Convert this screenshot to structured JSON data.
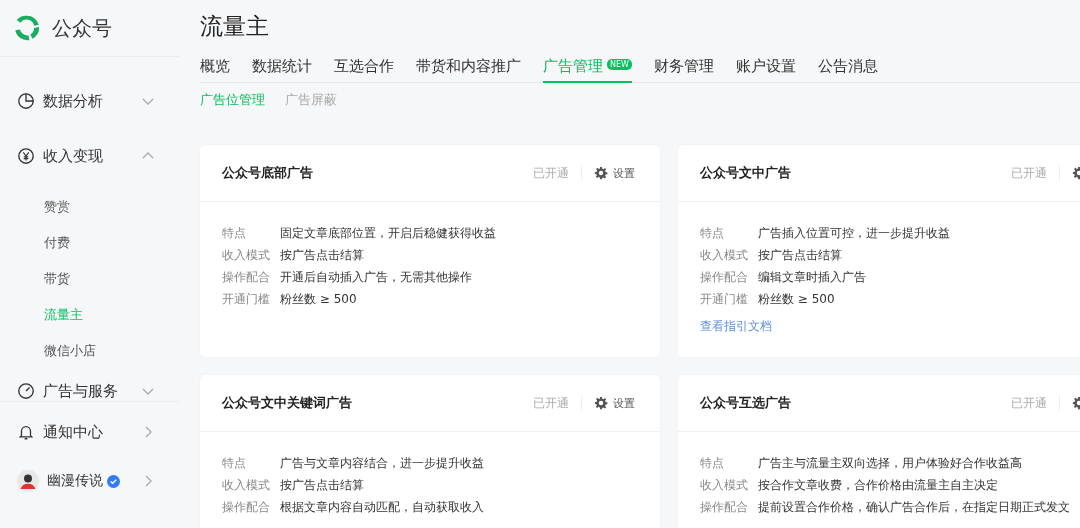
{
  "sidebar": {
    "logo": {
      "text": "公众号"
    },
    "menu": [
      {
        "label": "数据分析",
        "kind": "chart",
        "expanded": false
      },
      {
        "label": "收入变现",
        "kind": "income",
        "expanded": true,
        "children": [
          {
            "label": "赞赏",
            "selected": false
          },
          {
            "label": "付费",
            "selected": false
          },
          {
            "label": "带货",
            "selected": false
          },
          {
            "label": "流量主",
            "selected": true
          },
          {
            "label": "微信小店",
            "selected": false
          }
        ]
      },
      {
        "label": "广告与服务",
        "kind": "gauge",
        "expanded": false
      }
    ],
    "bottom": [
      {
        "label": "通知中心",
        "kind": "bell"
      }
    ],
    "user": {
      "name": "幽漫传说",
      "verified": true
    }
  },
  "page_title": "流量主",
  "tabs": [
    {
      "label": "概览",
      "selected": false
    },
    {
      "label": "数据统计",
      "selected": false
    },
    {
      "label": "互选合作",
      "selected": false
    },
    {
      "label": "带货和内容推广",
      "selected": false
    },
    {
      "label": "广告管理",
      "selected": true,
      "badge": "NEW"
    },
    {
      "label": "财务管理",
      "selected": false
    },
    {
      "label": "账户设置",
      "selected": false
    },
    {
      "label": "公告消息",
      "selected": false
    }
  ],
  "subtabs": [
    {
      "label": "广告位管理",
      "selected": true
    },
    {
      "label": "广告屏蔽",
      "selected": false
    }
  ],
  "cards": [
    {
      "title": "公众号底部广告",
      "status": "已开通",
      "settings": "设置",
      "rows": [
        {
          "label": "特点",
          "value": "固定文章底部位置，开启后稳健获得收益"
        },
        {
          "label": "收入模式",
          "value": "按广告点击结算"
        },
        {
          "label": "操作配合",
          "value": "开通后自动插入广告，无需其他操作"
        },
        {
          "label": "开通门槛",
          "value": "粉丝数 ≥ 500"
        }
      ]
    },
    {
      "title": "公众号文中广告",
      "status": "已开通",
      "rows": [
        {
          "label": "特点",
          "value": "广告插入位置可控，进一步提升收益"
        },
        {
          "label": "收入模式",
          "value": "按广告点击结算"
        },
        {
          "label": "操作配合",
          "value": "编辑文章时插入广告"
        },
        {
          "label": "开通门槛",
          "value": "粉丝数 ≥ 500"
        }
      ],
      "link": "查看指引文档"
    },
    {
      "title": "公众号文中关键词广告",
      "status": "已开通",
      "settings": "设置",
      "rows": [
        {
          "label": "特点",
          "value": "广告与文章内容结合，进一步提升收益"
        },
        {
          "label": "收入模式",
          "value": "按广告点击结算"
        },
        {
          "label": "操作配合",
          "value": "根据文章内容自动匹配，自动获取收入"
        }
      ]
    },
    {
      "title": "公众号互选广告",
      "status": "已开通",
      "rows": [
        {
          "label": "特点",
          "value": "广告主与流量主双向选择，用户体验好合作收益高"
        },
        {
          "label": "收入模式",
          "value": "按合作文章收费，合作价格由流量主自主决定"
        },
        {
          "label": "操作配合",
          "value": "提前设置合作价格，确认广告合作后，在指定日期正式发文"
        }
      ]
    }
  ]
}
